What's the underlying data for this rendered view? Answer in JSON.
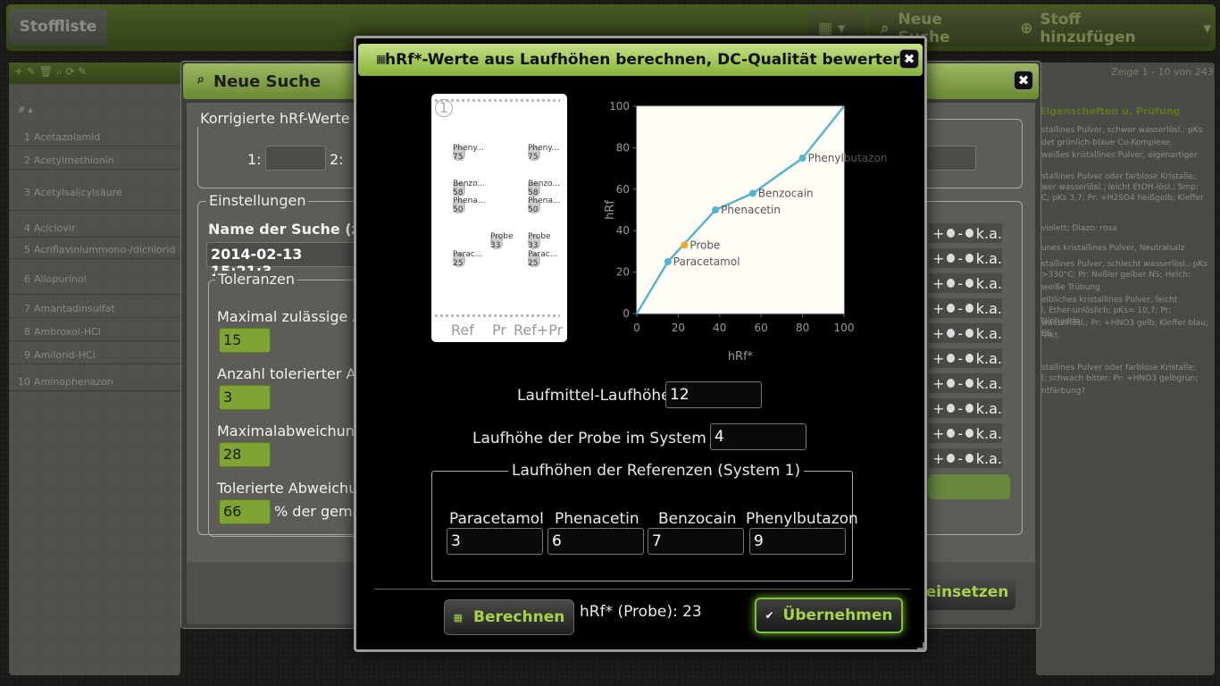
{
  "app": {
    "tab_stoffliste": "Stoffliste",
    "btn_neue_suche": "Neue Suche",
    "btn_stoff_hinzufuegen": "Stoff hinzufügen",
    "list_pager": "Zeige 1 - 10 von 243",
    "list_header": "# ▴",
    "list_items": [
      {
        "num": "1",
        "name": "Acetazolamid"
      },
      {
        "num": "2",
        "name": "Acetylmethionin"
      },
      {
        "num": "3",
        "name": "Acetylsalicylsäure"
      },
      {
        "num": "4",
        "name": "Aciclovir"
      },
      {
        "num": "5",
        "name": "Acriflaviniummono-/dichlorid"
      },
      {
        "num": "6",
        "name": "Allopurinol"
      },
      {
        "num": "7",
        "name": "Amantadinsulfat"
      },
      {
        "num": "8",
        "name": "Ambroxol-HCl"
      },
      {
        "num": "9",
        "name": "Amilorid-HCl"
      },
      {
        "num": "10",
        "name": "Aminophenazon"
      }
    ],
    "right_header": "Eigenschaften u. Prüfung",
    "right_rows": [
      "stallines Pulver, schwer wasserlösl.; pKs",
      "det grünlich-blaue Cu-Komplexe.",
      "weißes kristallines Pulver, eigenartiger",
      "stallines Pulver oder farblose Kristalle;",
      "wer wasserlösl.; leicht EtOH-lösl.; Smp:",
      "C; pKs 3,7; Pr: +H2SO4 heißgelb; Kieffer",
      "violett; Diazo: rosa",
      "unes kristallines Pulver, Neutralsalz",
      "stallines Pulver, schlecht wasserlösl.; pKs",
      ">330°C; Pr: Neßler gelber NS; Helch:",
      "weiße Trübung",
      "elbliches kristallines Pulver, leicht",
      "l, Ether-unlöslich; pKs= 10,7; Pr: Ninhydrin",
      "wasserlösl.; Pr: +HNO3 gelb; Kieffer blau; ES",
      "-Rkt.",
      "stallines Pulver oder farblose Kristalle;",
      "l; schwach bitter; Pr: +HNO3 gelbgrün;",
      "ntfärbung?"
    ]
  },
  "suche": {
    "title": "Neue Suche",
    "korr_legend": "Korrigierte hRf-Werte",
    "label_1": "1:",
    "label_2": "2:",
    "einst_legend": "Einstellungen",
    "name_label": "Name der Suche (z.",
    "name_value": "2014-02-13 15:21:3",
    "tol_legend": "Toleranzen",
    "max_label": "Maximal zulässige A",
    "max_value": "15",
    "anz_label": "Anzahl tolerierter A",
    "anz_value": "3",
    "maxabw_label": "Maximalabweichun",
    "maxabw_value": "28",
    "tolabw_label": "Tolerierte Abweichu",
    "tolabw_value": "66",
    "tolabw_suffix": "% der gema",
    "pm_text": "+ - k.a.",
    "einsetzen": "einsetzen"
  },
  "modal": {
    "title": "hRf*-Werte aus Laufhöhen berechnen, DC-Qualität bewerten",
    "tlc": {
      "number": "1",
      "lanes": [
        "Ref",
        "Pr",
        "Ref+Pr"
      ],
      "ref_spots": [
        {
          "label": "Pheny...",
          "value": "75"
        },
        {
          "label": "Benzo...",
          "value": "58"
        },
        {
          "label": "Phena...",
          "value": "50"
        },
        {
          "label": "Parac...",
          "value": "25"
        }
      ],
      "probe_spot": {
        "label": "Probe",
        "value": "33"
      },
      "mix_spots": [
        {
          "label": "Pheny...",
          "value": "75"
        },
        {
          "label": "Benzo...",
          "value": "58"
        },
        {
          "label": "Phena...",
          "value": "50"
        },
        {
          "label": "Probe",
          "value": "33"
        },
        {
          "label": "Parac...",
          "value": "25"
        }
      ]
    },
    "laufmittel_label": "Laufmittel-Laufhöhe",
    "laufmittel_value": "12",
    "probe_label": "Laufhöhe der Probe im System 1",
    "probe_value": "4",
    "ref_legend": "Laufhöhen der Referenzen (System 1)",
    "refs": [
      {
        "name": "Paracetamol",
        "value": "3"
      },
      {
        "name": "Phenacetin",
        "value": "6"
      },
      {
        "name": "Benzocain",
        "value": "7"
      },
      {
        "name": "Phenylbutazon",
        "value": "9"
      }
    ],
    "btn_berechnen": "Berechnen",
    "result_text": "hRf* (Probe): 23",
    "btn_uebernehmen": "Übernehmen",
    "colors": {
      "accent": "#8fc43e",
      "curve": "#5ab3cc",
      "probe": "#f5a623"
    }
  },
  "chart_data": {
    "type": "line",
    "xlabel": "hRf*",
    "ylabel": "hRf",
    "xlim": [
      0,
      100
    ],
    "ylim": [
      0,
      100
    ],
    "xticks": [
      0,
      20,
      40,
      60,
      80,
      100
    ],
    "yticks": [
      0,
      20,
      40,
      60,
      80,
      100
    ],
    "series": [
      {
        "values": [
          [
            0,
            0
          ],
          [
            15,
            25
          ],
          [
            38,
            50
          ],
          [
            56,
            58
          ],
          [
            80,
            75
          ],
          [
            100,
            100
          ]
        ]
      }
    ],
    "points": [
      {
        "name": "Paracetamol",
        "x": 15,
        "y": 25
      },
      {
        "name": "Phenacetin",
        "x": 38,
        "y": 50
      },
      {
        "name": "Benzocain",
        "x": 56,
        "y": 58
      },
      {
        "name": "Phenylbutazon",
        "x": 80,
        "y": 75
      }
    ],
    "probe": {
      "name": "Probe",
      "x": 23,
      "y": 33
    },
    "grid": false
  }
}
